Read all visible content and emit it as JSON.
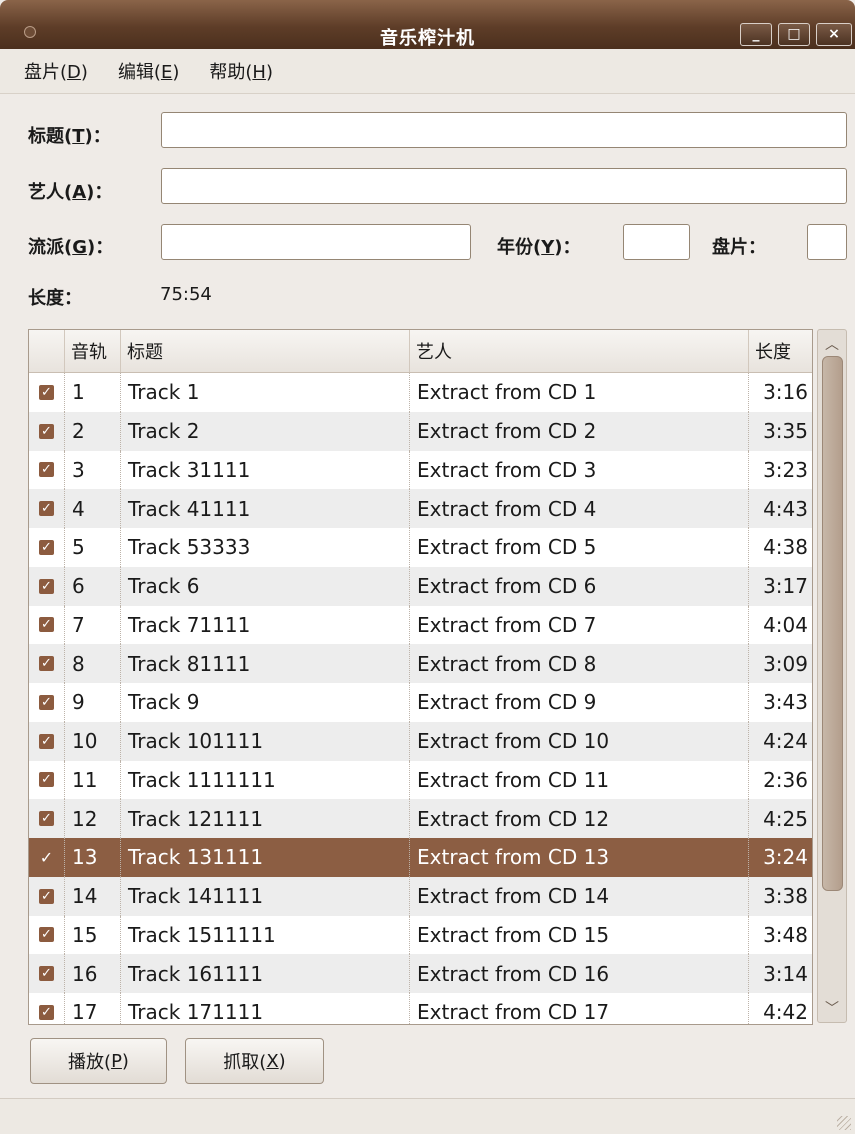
{
  "window": {
    "title": "音乐榨汁机",
    "minimize": "_",
    "maximize": "□",
    "close": "×"
  },
  "menu": [
    {
      "label": "盘片(",
      "key": "D",
      "end": ")"
    },
    {
      "label": "编辑(",
      "key": "E",
      "end": ")"
    },
    {
      "label": "帮助(",
      "key": "H",
      "end": ")"
    }
  ],
  "form": {
    "title_label": "标题(",
    "title_key": "T",
    "title_end": ")：",
    "title_value": "",
    "artist_label": "艺人(",
    "artist_key": "A",
    "artist_end": ")：",
    "artist_value": "",
    "genre_label": "流派(",
    "genre_key": "G",
    "genre_end": ")：",
    "genre_value": "",
    "year_label": "年份(",
    "year_key": "Y",
    "year_end": ")：",
    "year_value": "",
    "disc_label": "盘片：",
    "disc_value": "",
    "length_label": "长度：",
    "length_value": "75:54"
  },
  "list": {
    "headers": [
      "音轨",
      "标题",
      "艺人",
      "长度"
    ],
    "tracks": [
      {
        "num": "1",
        "title": "Track 1",
        "artist": "Extract from CD 1",
        "length": "3:16",
        "checked": true
      },
      {
        "num": "2",
        "title": "Track 2",
        "artist": "Extract from CD 2",
        "length": "3:35",
        "checked": true
      },
      {
        "num": "3",
        "title": "Track 31111",
        "artist": "Extract from CD 3",
        "length": "3:23",
        "checked": true
      },
      {
        "num": "4",
        "title": "Track 41111",
        "artist": "Extract from CD 4",
        "length": "4:43",
        "checked": true
      },
      {
        "num": "5",
        "title": "Track 53333",
        "artist": "Extract from CD 5",
        "length": "4:38",
        "checked": true
      },
      {
        "num": "6",
        "title": "Track 6",
        "artist": "Extract from CD 6",
        "length": "3:17",
        "checked": true
      },
      {
        "num": "7",
        "title": "Track 71111",
        "artist": "Extract from CD 7",
        "length": "4:04",
        "checked": true
      },
      {
        "num": "8",
        "title": "Track 81111",
        "artist": "Extract from CD 8",
        "length": "3:09",
        "checked": true
      },
      {
        "num": "9",
        "title": "Track 9",
        "artist": "Extract from CD 9",
        "length": "3:43",
        "checked": true
      },
      {
        "num": "10",
        "title": "Track 101111",
        "artist": "Extract from CD 10",
        "length": "4:24",
        "checked": true
      },
      {
        "num": "11",
        "title": "Track 1111111",
        "artist": "Extract from CD 11",
        "length": "2:36",
        "checked": true
      },
      {
        "num": "12",
        "title": "Track 121111",
        "artist": "Extract from CD 12",
        "length": "4:25",
        "checked": true
      },
      {
        "num": "13",
        "title": "Track 131111",
        "artist": "Extract from CD 13",
        "length": "3:24",
        "checked": true,
        "selected": true
      },
      {
        "num": "14",
        "title": "Track 141111",
        "artist": "Extract from CD 14",
        "length": "3:38",
        "checked": true
      },
      {
        "num": "15",
        "title": "Track 1511111",
        "artist": "Extract from CD 15",
        "length": "3:48",
        "checked": true
      },
      {
        "num": "16",
        "title": "Track 161111",
        "artist": "Extract from CD 16",
        "length": "3:14",
        "checked": true
      },
      {
        "num": "17",
        "title": "Track 171111",
        "artist": "Extract from CD 17",
        "length": "4:42",
        "checked": true
      }
    ]
  },
  "buttons": {
    "play_label": "播放(",
    "play_key": "P",
    "play_end": ")",
    "extract_label": "抓取(",
    "extract_key": "X",
    "extract_end": ")"
  },
  "icons": {
    "checkbox": "checkmark-icon",
    "scroll_up": "chevron-up-icon",
    "scroll_down": "chevron-down-icon"
  },
  "colors": {
    "titlebar": "#5e3d28",
    "selection": "#8c5e43",
    "checkbox": "#8c5b3f"
  }
}
